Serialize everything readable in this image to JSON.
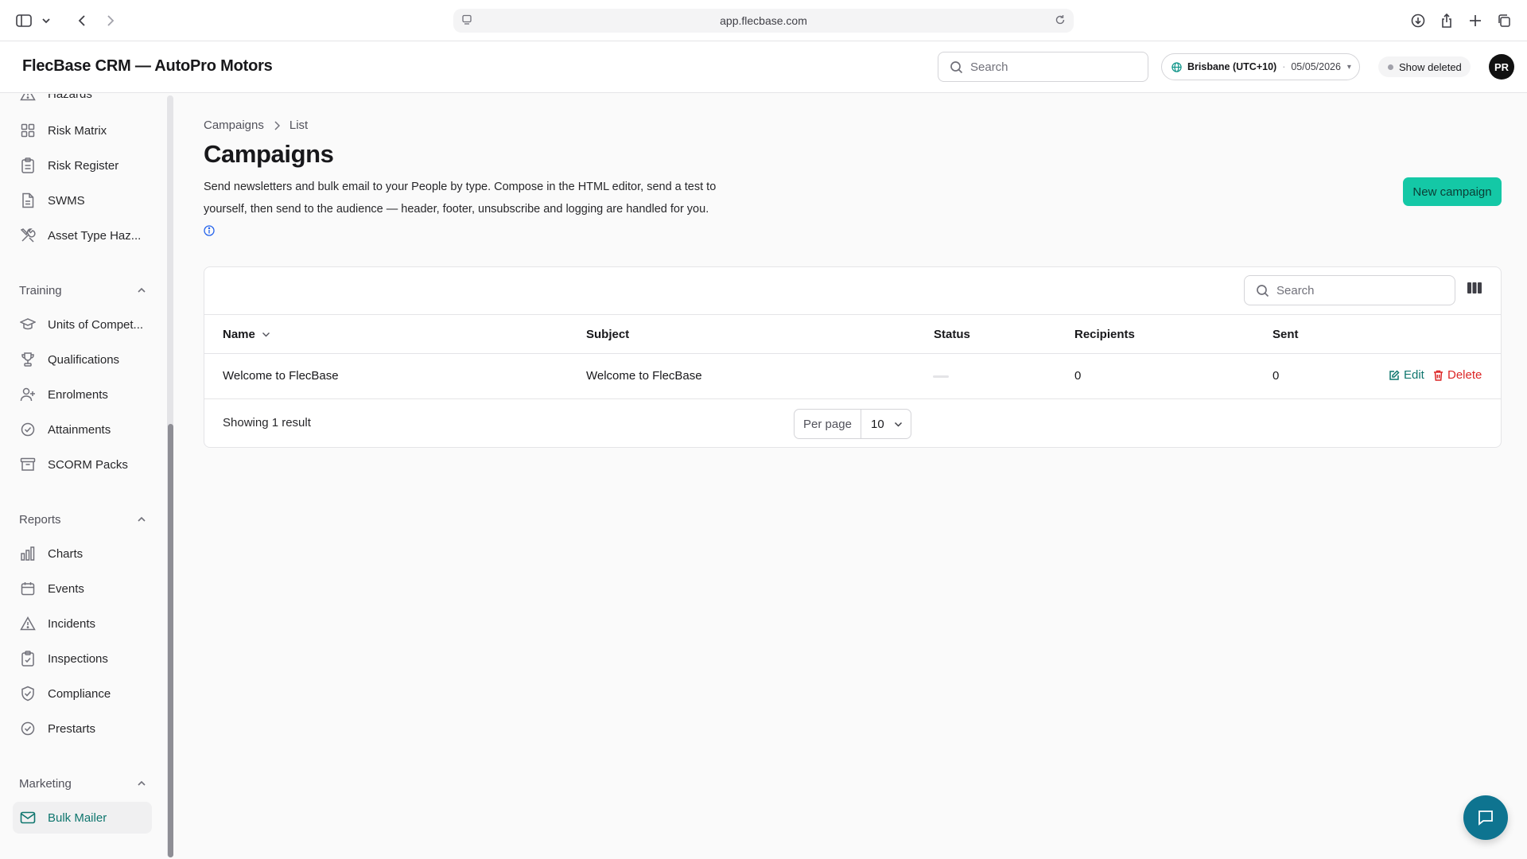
{
  "browser": {
    "url": "app.flecbase.com"
  },
  "header": {
    "app_title": "FlecBase CRM — AutoPro Motors",
    "search_placeholder": "Search",
    "timezone": "Brisbane (UTC+10)",
    "date": "05/05/2026",
    "timezone_separator": "·",
    "show_deleted_label": "Show deleted",
    "avatar_initials": "PR"
  },
  "sidebar": {
    "risk_items": [
      {
        "label": "Hazards",
        "icon": "alert-triangle-icon"
      },
      {
        "label": "Risk Matrix",
        "icon": "grid-icon"
      },
      {
        "label": "Risk Register",
        "icon": "clipboard-icon"
      },
      {
        "label": "SWMS",
        "icon": "document-icon"
      },
      {
        "label": "Asset Type Haz...",
        "icon": "tools-icon"
      }
    ],
    "training": {
      "title": "Training",
      "items": [
        {
          "label": "Units of Compet...",
          "icon": "graduation-cap-icon"
        },
        {
          "label": "Qualifications",
          "icon": "trophy-icon"
        },
        {
          "label": "Enrolments",
          "icon": "user-plus-icon"
        },
        {
          "label": "Attainments",
          "icon": "check-circle-icon"
        },
        {
          "label": "SCORM Packs",
          "icon": "archive-icon"
        }
      ]
    },
    "reports": {
      "title": "Reports",
      "items": [
        {
          "label": "Charts",
          "icon": "bar-chart-icon"
        },
        {
          "label": "Events",
          "icon": "calendar-icon"
        },
        {
          "label": "Incidents",
          "icon": "alert-triangle-icon"
        },
        {
          "label": "Inspections",
          "icon": "clipboard-check-icon"
        },
        {
          "label": "Compliance",
          "icon": "shield-check-icon"
        },
        {
          "label": "Prestarts",
          "icon": "check-circle-icon"
        }
      ]
    },
    "marketing": {
      "title": "Marketing",
      "items": [
        {
          "label": "Bulk Mailer",
          "icon": "mail-icon",
          "active": true
        }
      ]
    }
  },
  "main": {
    "breadcrumb": [
      "Campaigns",
      "List"
    ],
    "title": "Campaigns",
    "description": "Send newsletters and bulk email to your People by type. Compose in the HTML editor, send a test to yourself, then send to the audience — header, footer, unsubscribe and logging are handled for you.",
    "new_button": "New campaign",
    "table": {
      "search_placeholder": "Search",
      "columns": [
        "Name",
        "Subject",
        "Status",
        "Recipients",
        "Sent"
      ],
      "rows": [
        {
          "name": "Welcome to FlecBase",
          "subject": "Welcome to FlecBase",
          "status": "",
          "recipients": "0",
          "sent": "0"
        }
      ],
      "actions": {
        "edit": "Edit",
        "delete": "Delete"
      },
      "footer": {
        "showing": "Showing 1 result",
        "per_page_label": "Per page",
        "per_page_value": "10"
      }
    }
  },
  "colors": {
    "accent": "#14c8a6",
    "active_nav": "#0f766e",
    "danger": "#dc2626",
    "chat": "#0e7490"
  }
}
